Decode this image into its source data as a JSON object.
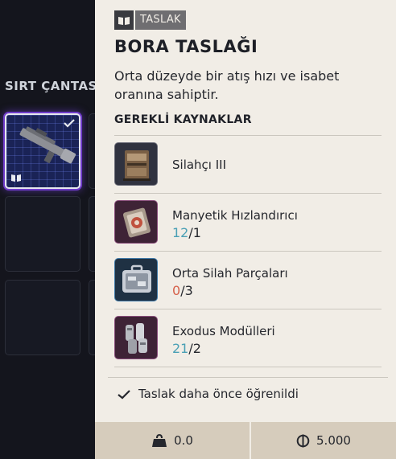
{
  "backpack": {
    "title": "SIRT ÇANTASI"
  },
  "tooltip": {
    "tag_label": "TASLAK",
    "title": "BORA TASLAĞI",
    "description": "Orta düzeyde bir atış hızı ve isabet oranına sahiptir.",
    "requirements_heading": "GEREKLİ KAYNAKLAR",
    "requirements": [
      {
        "name": "Silahçı III",
        "icon": "workbench-icon"
      },
      {
        "name": "Manyetik Hızlandırıcı",
        "have": "12",
        "sep": "/",
        "need": "1",
        "icon": "magnetic-accelerator-icon"
      },
      {
        "name": "Orta Silah Parçaları",
        "have": "0",
        "sep": "/",
        "need": "3",
        "icon": "weapon-parts-case-icon"
      },
      {
        "name": "Exodus Modülleri",
        "have": "21",
        "sep": "/",
        "need": "2",
        "icon": "exodus-modules-icon"
      }
    ],
    "learned_text": "Taslak daha önce öğrenildi",
    "weight": "0.0",
    "price": "5.000"
  },
  "colors": {
    "panel_bg": "#f1ede6",
    "footer_bg": "#d6ccbc",
    "count_ok": "#4aa0b5",
    "count_missing": "#d6604a",
    "selected_slot": "#1a2356",
    "selected_glow": "#6f3cc9"
  }
}
